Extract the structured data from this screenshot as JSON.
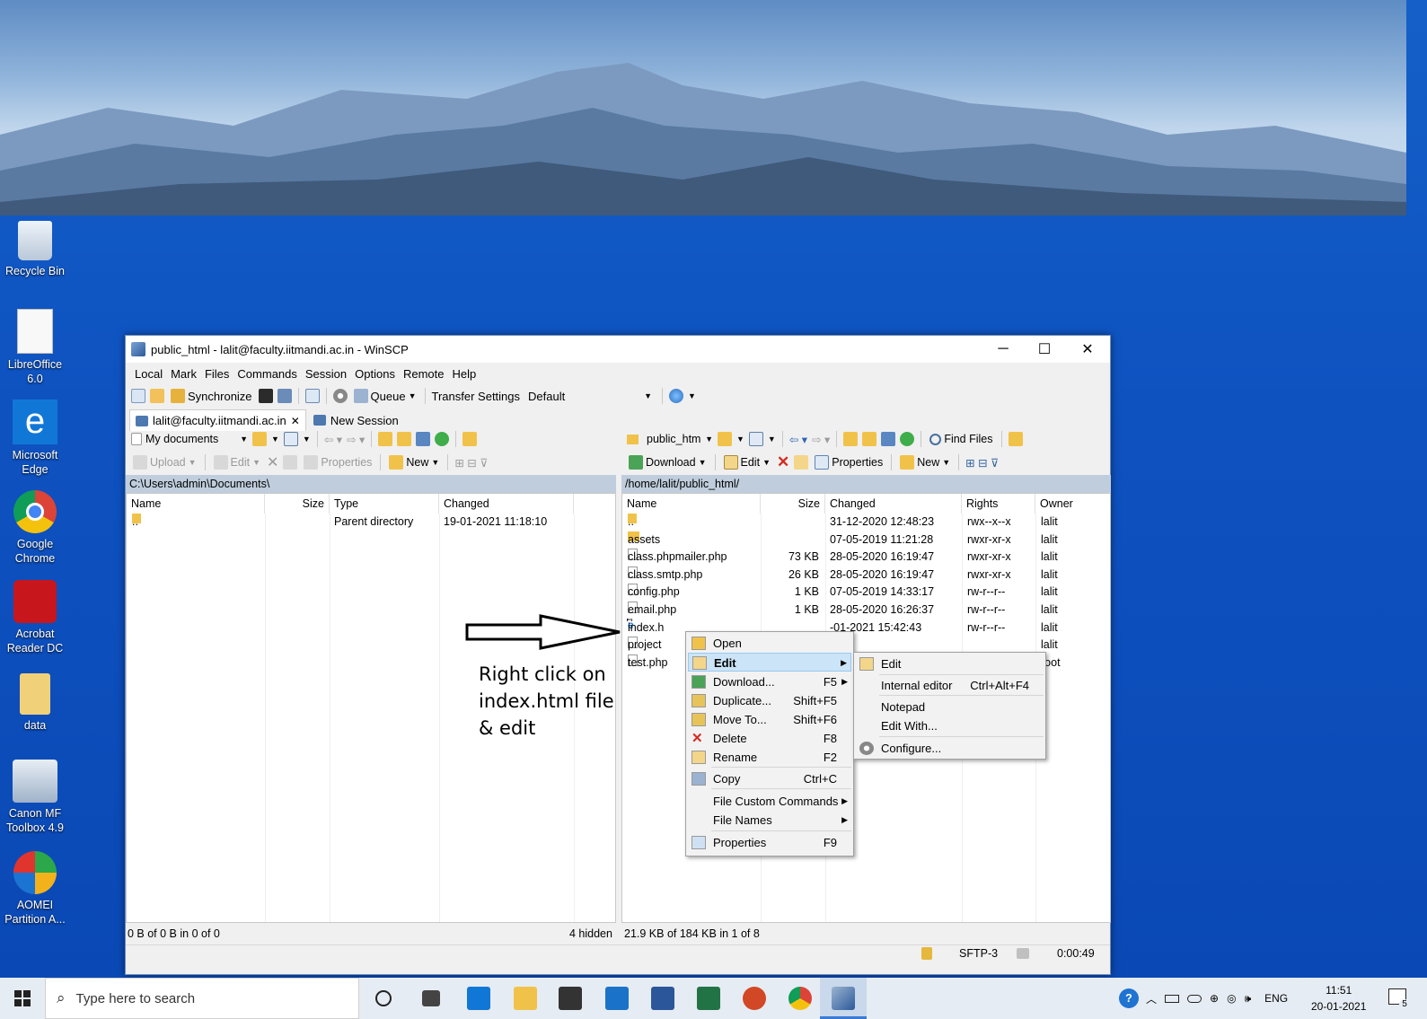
{
  "desktop": {
    "icons": [
      {
        "label": "Recycle Bin"
      },
      {
        "label": "LibreOffice 6.0"
      },
      {
        "label": "Microsoft Edge"
      },
      {
        "label": "Google Chrome"
      },
      {
        "label": "Acrobat Reader DC"
      },
      {
        "label": "data"
      },
      {
        "label": "Canon MF Toolbox 4.9"
      },
      {
        "label": "AOMEI Partition A..."
      }
    ]
  },
  "window": {
    "title": "public_html - lalit@faculty.iitmandi.ac.in - WinSCP",
    "minimize": "─",
    "maximize": "☐",
    "close": "✕"
  },
  "menubar": [
    "Local",
    "Mark",
    "Files",
    "Commands",
    "Session",
    "Options",
    "Remote",
    "Help"
  ],
  "toolbar": {
    "synchronize": "Synchronize",
    "queue": "Queue",
    "transfer_settings": "Transfer Settings",
    "transfer_value": "Default"
  },
  "tabs": {
    "session": "lalit@faculty.iitmandi.ac.in",
    "new_session": "New Session"
  },
  "left": {
    "location": "My documents",
    "actions": {
      "upload": "Upload",
      "edit": "Edit",
      "properties": "Properties",
      "new": "New"
    },
    "path": "C:\\Users\\admin\\Documents\\",
    "columns": {
      "name": "Name",
      "size": "Size",
      "type": "Type",
      "changed": "Changed"
    },
    "rows": [
      {
        "name": "..",
        "size": "",
        "type": "Parent directory",
        "changed": "19-01-2021  11:18:10"
      }
    ],
    "status": "0 B of 0 B in 0 of 0",
    "hidden": "4 hidden"
  },
  "right": {
    "location": "public_htm",
    "actions": {
      "download": "Download",
      "edit": "Edit",
      "properties": "Properties",
      "new": "New",
      "find_files": "Find Files"
    },
    "path": "/home/lalit/public_html/",
    "columns": {
      "name": "Name",
      "size": "Size",
      "changed": "Changed",
      "rights": "Rights",
      "owner": "Owner"
    },
    "rows": [
      {
        "name": "..",
        "size": "",
        "changed": "31-12-2020 12:48:23",
        "rights": "rwx--x--x",
        "owner": "lalit",
        "kind": "up"
      },
      {
        "name": "assets",
        "size": "",
        "changed": "07-05-2019 11:21:28",
        "rights": "rwxr-xr-x",
        "owner": "lalit",
        "kind": "folder"
      },
      {
        "name": "class.phpmailer.php",
        "size": "73 KB",
        "changed": "28-05-2020 16:19:47",
        "rights": "rwxr-xr-x",
        "owner": "lalit",
        "kind": "file"
      },
      {
        "name": "class.smtp.php",
        "size": "26 KB",
        "changed": "28-05-2020 16:19:47",
        "rights": "rwxr-xr-x",
        "owner": "lalit",
        "kind": "file"
      },
      {
        "name": "config.php",
        "size": "1 KB",
        "changed": "07-05-2019 14:33:17",
        "rights": "rw-r--r--",
        "owner": "lalit",
        "kind": "file"
      },
      {
        "name": "email.php",
        "size": "1 KB",
        "changed": "28-05-2020 16:26:37",
        "rights": "rw-r--r--",
        "owner": "lalit",
        "kind": "file"
      },
      {
        "name": "index.h",
        "size": "",
        "changed": "-01-2021 15:42:43",
        "rights": "rw-r--r--",
        "owner": "lalit",
        "kind": "html"
      },
      {
        "name": "project",
        "size": "",
        "changed": "",
        "rights": "",
        "owner": "lalit",
        "kind": "file"
      },
      {
        "name": "test.php",
        "size": "",
        "changed": "",
        "rights": "",
        "owner": "root",
        "kind": "file"
      }
    ],
    "status": "21.9 KB of 184 KB in 1 of 8"
  },
  "statusbar": {
    "protocol": "SFTP-3",
    "timer": "0:00:49"
  },
  "annotation": {
    "lines": [
      "Right click on",
      "index.html file",
      "& edit"
    ]
  },
  "context_menu": [
    {
      "label": "Open",
      "shortcut": ""
    },
    {
      "label": "Edit",
      "shortcut": ""
    },
    {
      "label": "Download...",
      "shortcut": "F5"
    },
    {
      "label": "Duplicate...",
      "shortcut": "Shift+F5"
    },
    {
      "label": "Move To...",
      "shortcut": "Shift+F6"
    },
    {
      "label": "Delete",
      "shortcut": "F8"
    },
    {
      "label": "Rename",
      "shortcut": "F2"
    },
    {
      "label": "Copy",
      "shortcut": "Ctrl+C"
    },
    {
      "label": "File Custom Commands",
      "shortcut": ""
    },
    {
      "label": "File Names",
      "shortcut": ""
    },
    {
      "label": "Properties",
      "shortcut": "F9"
    }
  ],
  "submenu": [
    {
      "label": "Edit",
      "shortcut": ""
    },
    {
      "label": "Internal editor",
      "shortcut": "Ctrl+Alt+F4"
    },
    {
      "label": "Notepad",
      "shortcut": ""
    },
    {
      "label": "Edit With...",
      "shortcut": ""
    },
    {
      "label": "Configure...",
      "shortcut": ""
    }
  ],
  "taskbar": {
    "search_placeholder": "Type here to search",
    "lang": "ENG",
    "time": "11:51",
    "date": "20-01-2021",
    "notif_count": "5"
  }
}
